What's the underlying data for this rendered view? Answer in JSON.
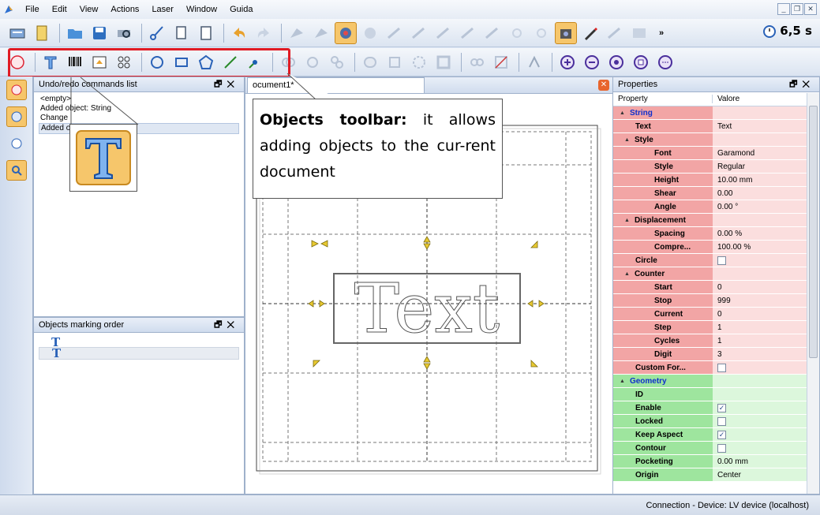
{
  "menu": {
    "items": [
      "File",
      "Edit",
      "View",
      "Actions",
      "Laser",
      "Window",
      "Guida"
    ]
  },
  "toolbar": {
    "time": "6,5 s",
    "overflow": "»"
  },
  "undo_panel": {
    "title": "Undo/redo commands list",
    "items": [
      "<empty>",
      "Added object: String",
      "Change",
      "Added o"
    ]
  },
  "marking_panel": {
    "title": "Objects marking order"
  },
  "document": {
    "tab_label": "ocument1*",
    "text": "Text"
  },
  "callout": {
    "bold": "Objects toolbar:",
    "text": " it allows adding objects to the cur-rent document"
  },
  "properties": {
    "title": "Properties",
    "col_property": "Property",
    "col_value": "Valore",
    "rows": [
      {
        "key": "String",
        "value": "",
        "indent": 0,
        "color": "red",
        "section": true,
        "expander": "▲"
      },
      {
        "key": "Text",
        "value": "Text",
        "indent": 1,
        "color": "red"
      },
      {
        "key": "Style",
        "value": "",
        "indent": 1,
        "color": "red",
        "expander": "▲"
      },
      {
        "key": "Font",
        "value": "Garamond",
        "indent": 2,
        "color": "red"
      },
      {
        "key": "Style",
        "value": "Regular",
        "indent": 2,
        "color": "red"
      },
      {
        "key": "Height",
        "value": "10.00 mm",
        "indent": 2,
        "color": "red"
      },
      {
        "key": "Shear",
        "value": "0.00",
        "indent": 2,
        "color": "red"
      },
      {
        "key": "Angle",
        "value": "0.00 °",
        "indent": 2,
        "color": "red"
      },
      {
        "key": "Displacement",
        "value": "",
        "indent": 1,
        "color": "red",
        "expander": "▲"
      },
      {
        "key": "Spacing",
        "value": "0.00 %",
        "indent": 2,
        "color": "red"
      },
      {
        "key": "Compre...",
        "value": "100.00 %",
        "indent": 2,
        "color": "red"
      },
      {
        "key": "Circle",
        "value": "",
        "indent": 1,
        "color": "red",
        "checkbox": false
      },
      {
        "key": "Counter",
        "value": "",
        "indent": 1,
        "color": "red",
        "expander": "▲"
      },
      {
        "key": "Start",
        "value": "0",
        "indent": 2,
        "color": "red"
      },
      {
        "key": "Stop",
        "value": "999",
        "indent": 2,
        "color": "red"
      },
      {
        "key": "Current",
        "value": "0",
        "indent": 2,
        "color": "red"
      },
      {
        "key": "Step",
        "value": "1",
        "indent": 2,
        "color": "red"
      },
      {
        "key": "Cycles",
        "value": "1",
        "indent": 2,
        "color": "red"
      },
      {
        "key": "Digit",
        "value": "3",
        "indent": 2,
        "color": "red"
      },
      {
        "key": "Custom For...",
        "value": "",
        "indent": 1,
        "color": "red",
        "checkbox": false
      },
      {
        "key": "Geometry",
        "value": "",
        "indent": 0,
        "color": "green",
        "section": true,
        "expander": "▲"
      },
      {
        "key": "ID",
        "value": "",
        "indent": 1,
        "color": "green"
      },
      {
        "key": "Enable",
        "value": "",
        "indent": 1,
        "color": "green",
        "checkbox": true
      },
      {
        "key": "Locked",
        "value": "",
        "indent": 1,
        "color": "green",
        "checkbox": false
      },
      {
        "key": "Keep Aspect",
        "value": "",
        "indent": 1,
        "color": "green",
        "checkbox": true
      },
      {
        "key": "Contour",
        "value": "",
        "indent": 1,
        "color": "green",
        "checkbox": false
      },
      {
        "key": "Pocketing",
        "value": "0.00 mm",
        "indent": 1,
        "color": "green"
      },
      {
        "key": "Origin",
        "value": "Center",
        "indent": 1,
        "color": "green"
      }
    ]
  },
  "status": {
    "text": "Connection - Device: LV device (localhost)"
  },
  "colors": {
    "highlight_red": "#e01b24",
    "string_section": "#f2a5a5",
    "geometry_section": "#9ee59e"
  }
}
